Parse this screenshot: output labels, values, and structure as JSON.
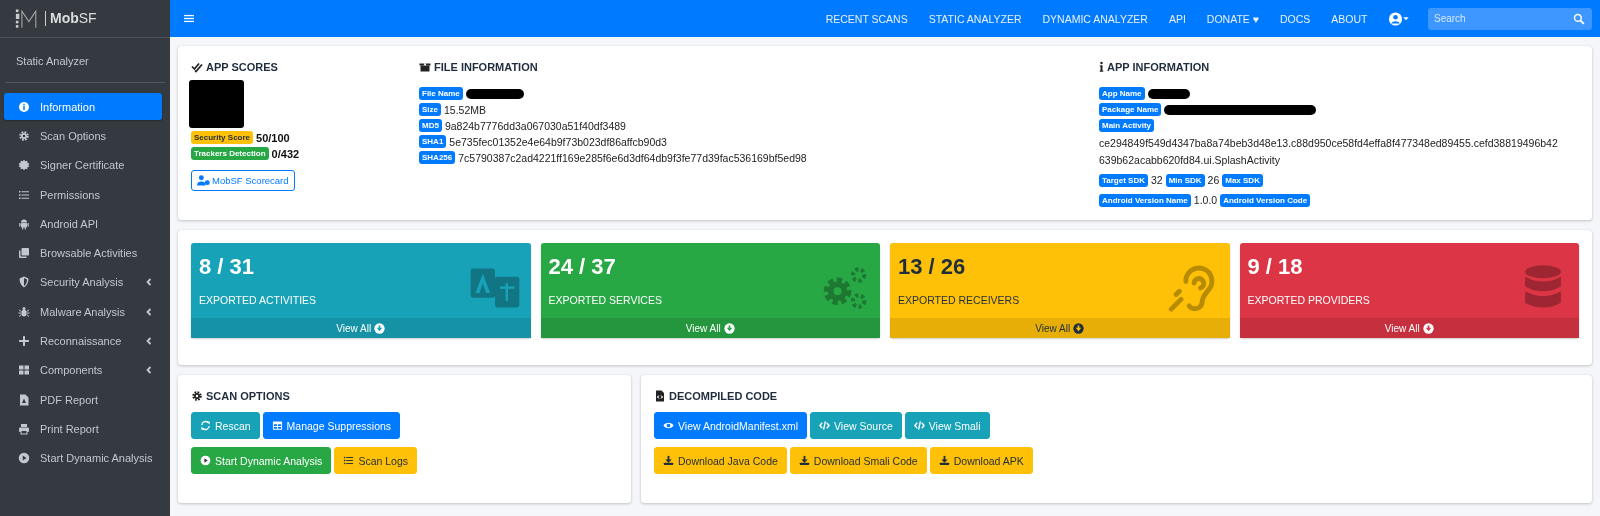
{
  "brand": {
    "name": "**Mob**SF"
  },
  "nav": {
    "items": [
      "RECENT SCANS",
      "STATIC ANALYZER",
      "DYNAMIC ANALYZER",
      "API",
      "DONATE ♥",
      "DOCS",
      "ABOUT"
    ],
    "search": {
      "placeholder": "Search"
    }
  },
  "sidebar": {
    "title": "Static Analyzer",
    "items": [
      {
        "label": "Information",
        "selected": true,
        "expandable": false
      },
      {
        "label": "Scan Options",
        "selected": false,
        "expandable": false
      },
      {
        "label": "Signer Certificate",
        "selected": false,
        "expandable": false
      },
      {
        "label": "Permissions",
        "selected": false,
        "expandable": false
      },
      {
        "label": "Android API",
        "selected": false,
        "expandable": false
      },
      {
        "label": "Browsable Activities",
        "selected": false,
        "expandable": false
      },
      {
        "label": "Security Analysis",
        "selected": false,
        "expandable": true
      },
      {
        "label": "Malware Analysis",
        "selected": false,
        "expandable": true
      },
      {
        "label": "Reconnaissance",
        "selected": false,
        "expandable": true
      },
      {
        "label": "Components",
        "selected": false,
        "expandable": true
      },
      {
        "label": "PDF Report",
        "selected": false,
        "expandable": false
      },
      {
        "label": "Print Report",
        "selected": false,
        "expandable": false
      },
      {
        "label": "Start Dynamic Analysis",
        "selected": false,
        "expandable": false
      }
    ]
  },
  "app_scores": {
    "title": "APP SCORES",
    "app_icon": {
      "redacted": true
    },
    "scores": [
      {
        "label": "Security Score",
        "value": "50/100",
        "color": "#ffc107"
      },
      {
        "label": "Trackers Detection",
        "value": "0/432",
        "color": "#28a745"
      }
    ],
    "scorecard_button": "MobSF Scorecard"
  },
  "file_information": {
    "title": "FILE INFORMATION",
    "lines": [
      {
        "parts": [
          {
            "kind": "badge",
            "text": "File Name"
          },
          {
            "kind": "redacted"
          }
        ]
      },
      {
        "parts": [
          {
            "kind": "badge",
            "text": "Size"
          },
          {
            "kind": "text",
            "text": "15.52MB"
          }
        ]
      },
      {
        "parts": [
          {
            "kind": "badge",
            "text": "MD5"
          },
          {
            "kind": "text",
            "text": "9a824b7776dd3a067030a51f40df3489"
          }
        ]
      },
      {
        "parts": [
          {
            "kind": "badge",
            "text": "SHA1"
          },
          {
            "kind": "text",
            "text": "5e735fec01352e4e64b9f73b023df86affcb90d3"
          }
        ]
      },
      {
        "parts": [
          {
            "kind": "badge",
            "text": "SHA256"
          },
          {
            "kind": "text",
            "text": "7c5790387c2ad4221ff169e285f6e6d3df64db9f3fe77d39fac536169bf5ed98"
          }
        ]
      }
    ]
  },
  "app_information": {
    "title": "APP INFORMATION",
    "lines": [
      {
        "parts": [
          {
            "kind": "badge",
            "text": "App Name"
          },
          {
            "kind": "redacted"
          }
        ]
      },
      {
        "parts": [
          {
            "kind": "badge",
            "text": "Package Name"
          },
          {
            "kind": "redacted"
          }
        ]
      },
      {
        "parts": [
          {
            "kind": "badge",
            "text": "Main Activity"
          }
        ]
      },
      {
        "parts": [
          {
            "kind": "text",
            "text": "ce294849f549d4347ba8a74beb3d48e13.c88d950ce58fd4effa8f477348ed89455.cefd38819496b42639b62acabb620fd84.ui.SplashActivity"
          }
        ]
      },
      {
        "parts": [
          {
            "kind": "badge",
            "text": "Target SDK"
          },
          {
            "kind": "text",
            "text": "32"
          },
          {
            "kind": "badge",
            "text": "Min SDK"
          },
          {
            "kind": "text",
            "text": "26"
          },
          {
            "kind": "badge",
            "text": "Max SDK"
          }
        ]
      },
      {
        "parts": [
          {
            "kind": "badge",
            "text": "Android Version Name"
          },
          {
            "kind": "text",
            "text": "1.0.0"
          },
          {
            "kind": "badge",
            "text": "Android Version Code"
          }
        ]
      }
    ]
  },
  "stats": [
    {
      "value": "8 / 31",
      "label": "EXPORTED ACTIVITIES",
      "link": "View All",
      "color": "#17a2b8"
    },
    {
      "value": "24 / 37",
      "label": "EXPORTED SERVICES",
      "link": "View All",
      "color": "#28a745"
    },
    {
      "value": "13 / 26",
      "label": "EXPORTED RECEIVERS",
      "link": "View All",
      "color": "#ffc107"
    },
    {
      "value": "9 / 18",
      "label": "EXPORTED PROVIDERS",
      "link": "View All",
      "color": "#dc3545"
    }
  ],
  "scan_options": {
    "title": "SCAN OPTIONS",
    "button_rows": [
      [
        {
          "label": "Rescan",
          "color": "#17a2b8"
        },
        {
          "label": "Manage Suppressions",
          "color": "#007bff"
        }
      ],
      [
        {
          "label": "Start Dynamic Analysis",
          "color": "#28a745"
        },
        {
          "label": "Scan Logs",
          "color": "#ffc107"
        }
      ]
    ]
  },
  "decompiled_code": {
    "title": "DECOMPILED CODE",
    "button_rows": [
      [
        {
          "label": "View AndroidManifest.xml",
          "color": "#007bff"
        },
        {
          "label": "View Source",
          "color": "#17a2b8"
        },
        {
          "label": "View Smali",
          "color": "#17a2b8"
        }
      ],
      [
        {
          "label": "Download Java Code",
          "color": "#ffc107"
        },
        {
          "label": "Download Smali Code",
          "color": "#ffc107"
        },
        {
          "label": "Download APK",
          "color": "#ffc107"
        }
      ]
    ]
  }
}
